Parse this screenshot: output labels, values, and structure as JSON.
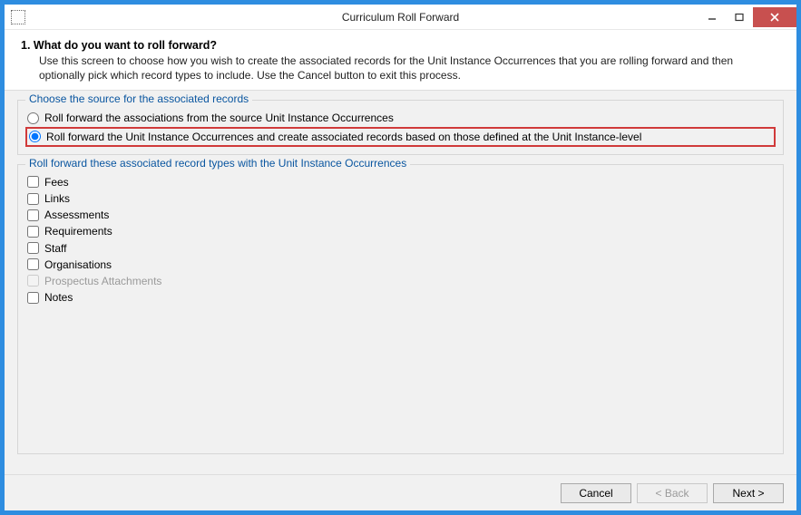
{
  "title": "Curriculum Roll Forward",
  "step": {
    "heading": "1. What do you want to roll forward?",
    "description": "Use this screen to choose how you wish to create the associated records for the Unit Instance Occurrences that you are rolling forward and then optionally pick which record types to include.  Use the Cancel button to exit this process."
  },
  "source_group": {
    "legend": "Choose the source for the associated records",
    "options": [
      {
        "label": "Roll forward the associations from the source Unit Instance Occurrences",
        "selected": false
      },
      {
        "label": "Roll forward the Unit Instance Occurrences and create associated records based on those defined at the Unit Instance-level",
        "selected": true
      }
    ]
  },
  "types_group": {
    "legend": "Roll forward these associated record types with the Unit Instance Occurrences",
    "items": [
      {
        "label": "Fees",
        "checked": false,
        "enabled": true
      },
      {
        "label": "Links",
        "checked": false,
        "enabled": true
      },
      {
        "label": "Assessments",
        "checked": false,
        "enabled": true
      },
      {
        "label": "Requirements",
        "checked": false,
        "enabled": true
      },
      {
        "label": "Staff",
        "checked": false,
        "enabled": true
      },
      {
        "label": "Organisations",
        "checked": false,
        "enabled": true
      },
      {
        "label": "Prospectus Attachments",
        "checked": false,
        "enabled": false
      },
      {
        "label": "Notes",
        "checked": false,
        "enabled": true
      }
    ]
  },
  "buttons": {
    "cancel": "Cancel",
    "back": "< Back",
    "next": "Next >"
  }
}
